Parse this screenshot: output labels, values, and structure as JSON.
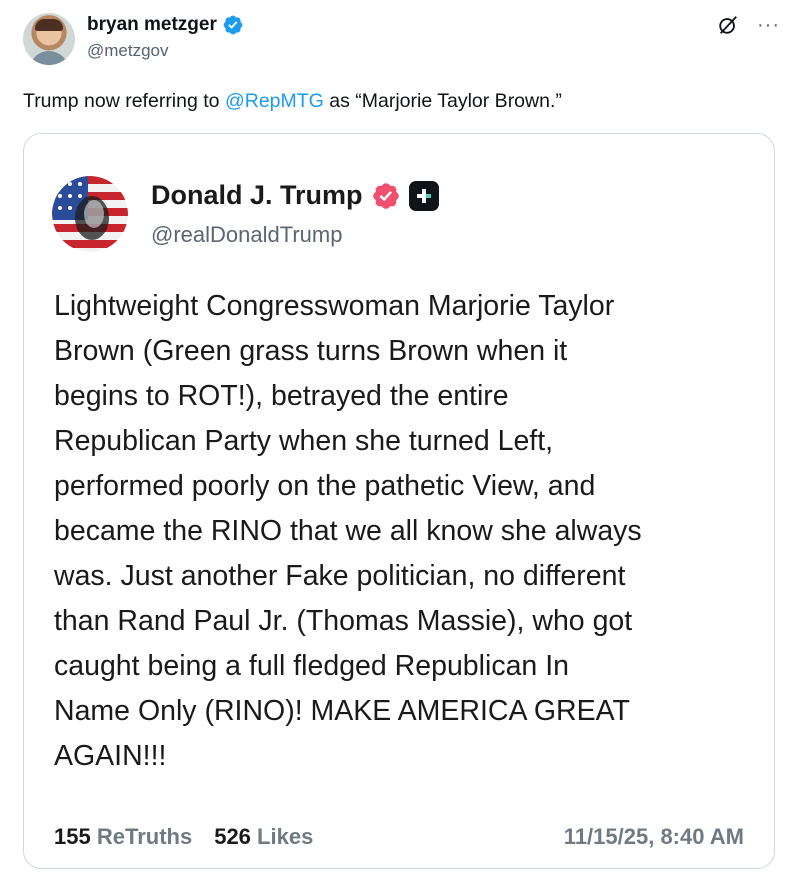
{
  "author": {
    "display_name": "bryan metzger",
    "handle": "@metzgov"
  },
  "tweet": {
    "text_before": "Trump now referring to ",
    "mention": "@RepMTG",
    "text_after": " as “Marjorie Taylor Brown.”"
  },
  "icons": {
    "verified": "verified-badge-icon",
    "grok": "grok-icon",
    "more": "more-options-icon"
  },
  "colors": {
    "link": "#1d9bf0",
    "verified_blue": "#1d9bf0",
    "truth_verified": "#f0506e"
  },
  "embedded": {
    "display_name": "Donald J. Trump",
    "handle": "@realDonaldTrump",
    "body_lines": [
      "Lightweight Congresswoman Marjorie Taylor",
      "Brown (Green grass turns Brown when it",
      "begins to ROT!), betrayed the entire",
      "Republican Party when she turned Left,",
      "performed poorly on the pathetic View, and",
      "became the RINO that we all know she always",
      "was. Just another Fake politician, no different",
      "than Rand Paul Jr. (Thomas Massie), who got",
      "caught being a full fledged Republican In",
      "Name Only (RINO)! MAKE AMERICA GREAT",
      "AGAIN!!!"
    ],
    "retruths_count": "155",
    "retruths_label": "ReTruths",
    "likes_count": "526",
    "likes_label": "Likes",
    "timestamp": "11/15/25, 8:40 AM"
  }
}
